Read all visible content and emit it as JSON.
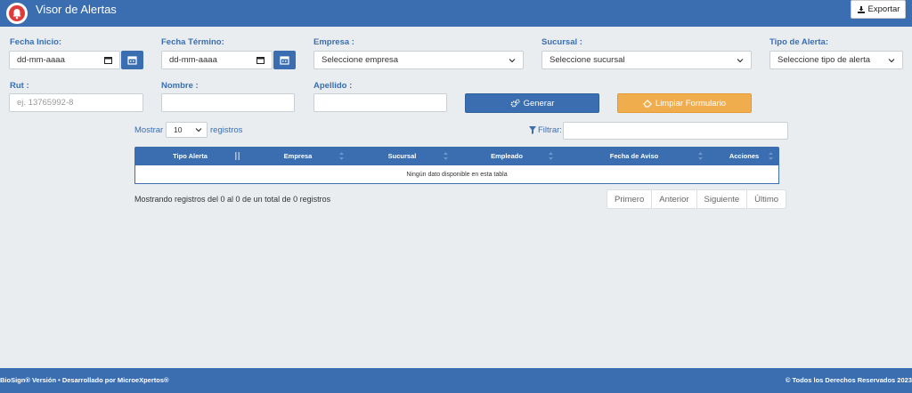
{
  "header": {
    "title": "Visor de Alertas",
    "export_label": "Exportar"
  },
  "form": {
    "fecha_inicio": {
      "label": "Fecha Inicio:",
      "value": "dd-mm-aaaa"
    },
    "fecha_termino": {
      "label": "Fecha Término:",
      "value": "dd-mm-aaaa"
    },
    "empresa": {
      "label": "Empresa :",
      "selected": "Seleccione empresa"
    },
    "sucursal": {
      "label": "Sucursal :",
      "selected": "Seleccione sucursal"
    },
    "tipo_alerta": {
      "label": "Tipo de Alerta:",
      "selected": "Seleccione tipo de alerta"
    },
    "rut": {
      "label": "Rut :",
      "placeholder": "ej. 13765992-8"
    },
    "nombre": {
      "label": "Nombre :",
      "value": ""
    },
    "apellido": {
      "label": "Apellido :",
      "value": ""
    },
    "generar_label": "Generar",
    "limpiar_label": "Limpiar Formulario"
  },
  "table_controls": {
    "mostrar": "Mostrar",
    "length_value": "10",
    "registros": "registros",
    "filtrar": "Filtrar:"
  },
  "table": {
    "columns": [
      "Tipo Alerta",
      "Empresa",
      "Sucursal",
      "Empleado",
      "Fecha de Aviso",
      "Acciones"
    ],
    "empty_message": "Ningún dato disponible en esta tabla"
  },
  "info_text": "Mostrando registros del 0 al 0 de un total de 0 registros",
  "pagination": [
    "Primero",
    "Anterior",
    "Siguiente",
    "Último"
  ],
  "footer": {
    "left": "BioSign® Versión • Desarrollado por MicroeXpertos®",
    "right": "© Todos los Derechos Reservados 2023"
  },
  "colors": {
    "primary": "#3a6eb1",
    "warning": "#f0ad4e",
    "background": "#e9edef",
    "alert_icon": "#e03b3b"
  }
}
